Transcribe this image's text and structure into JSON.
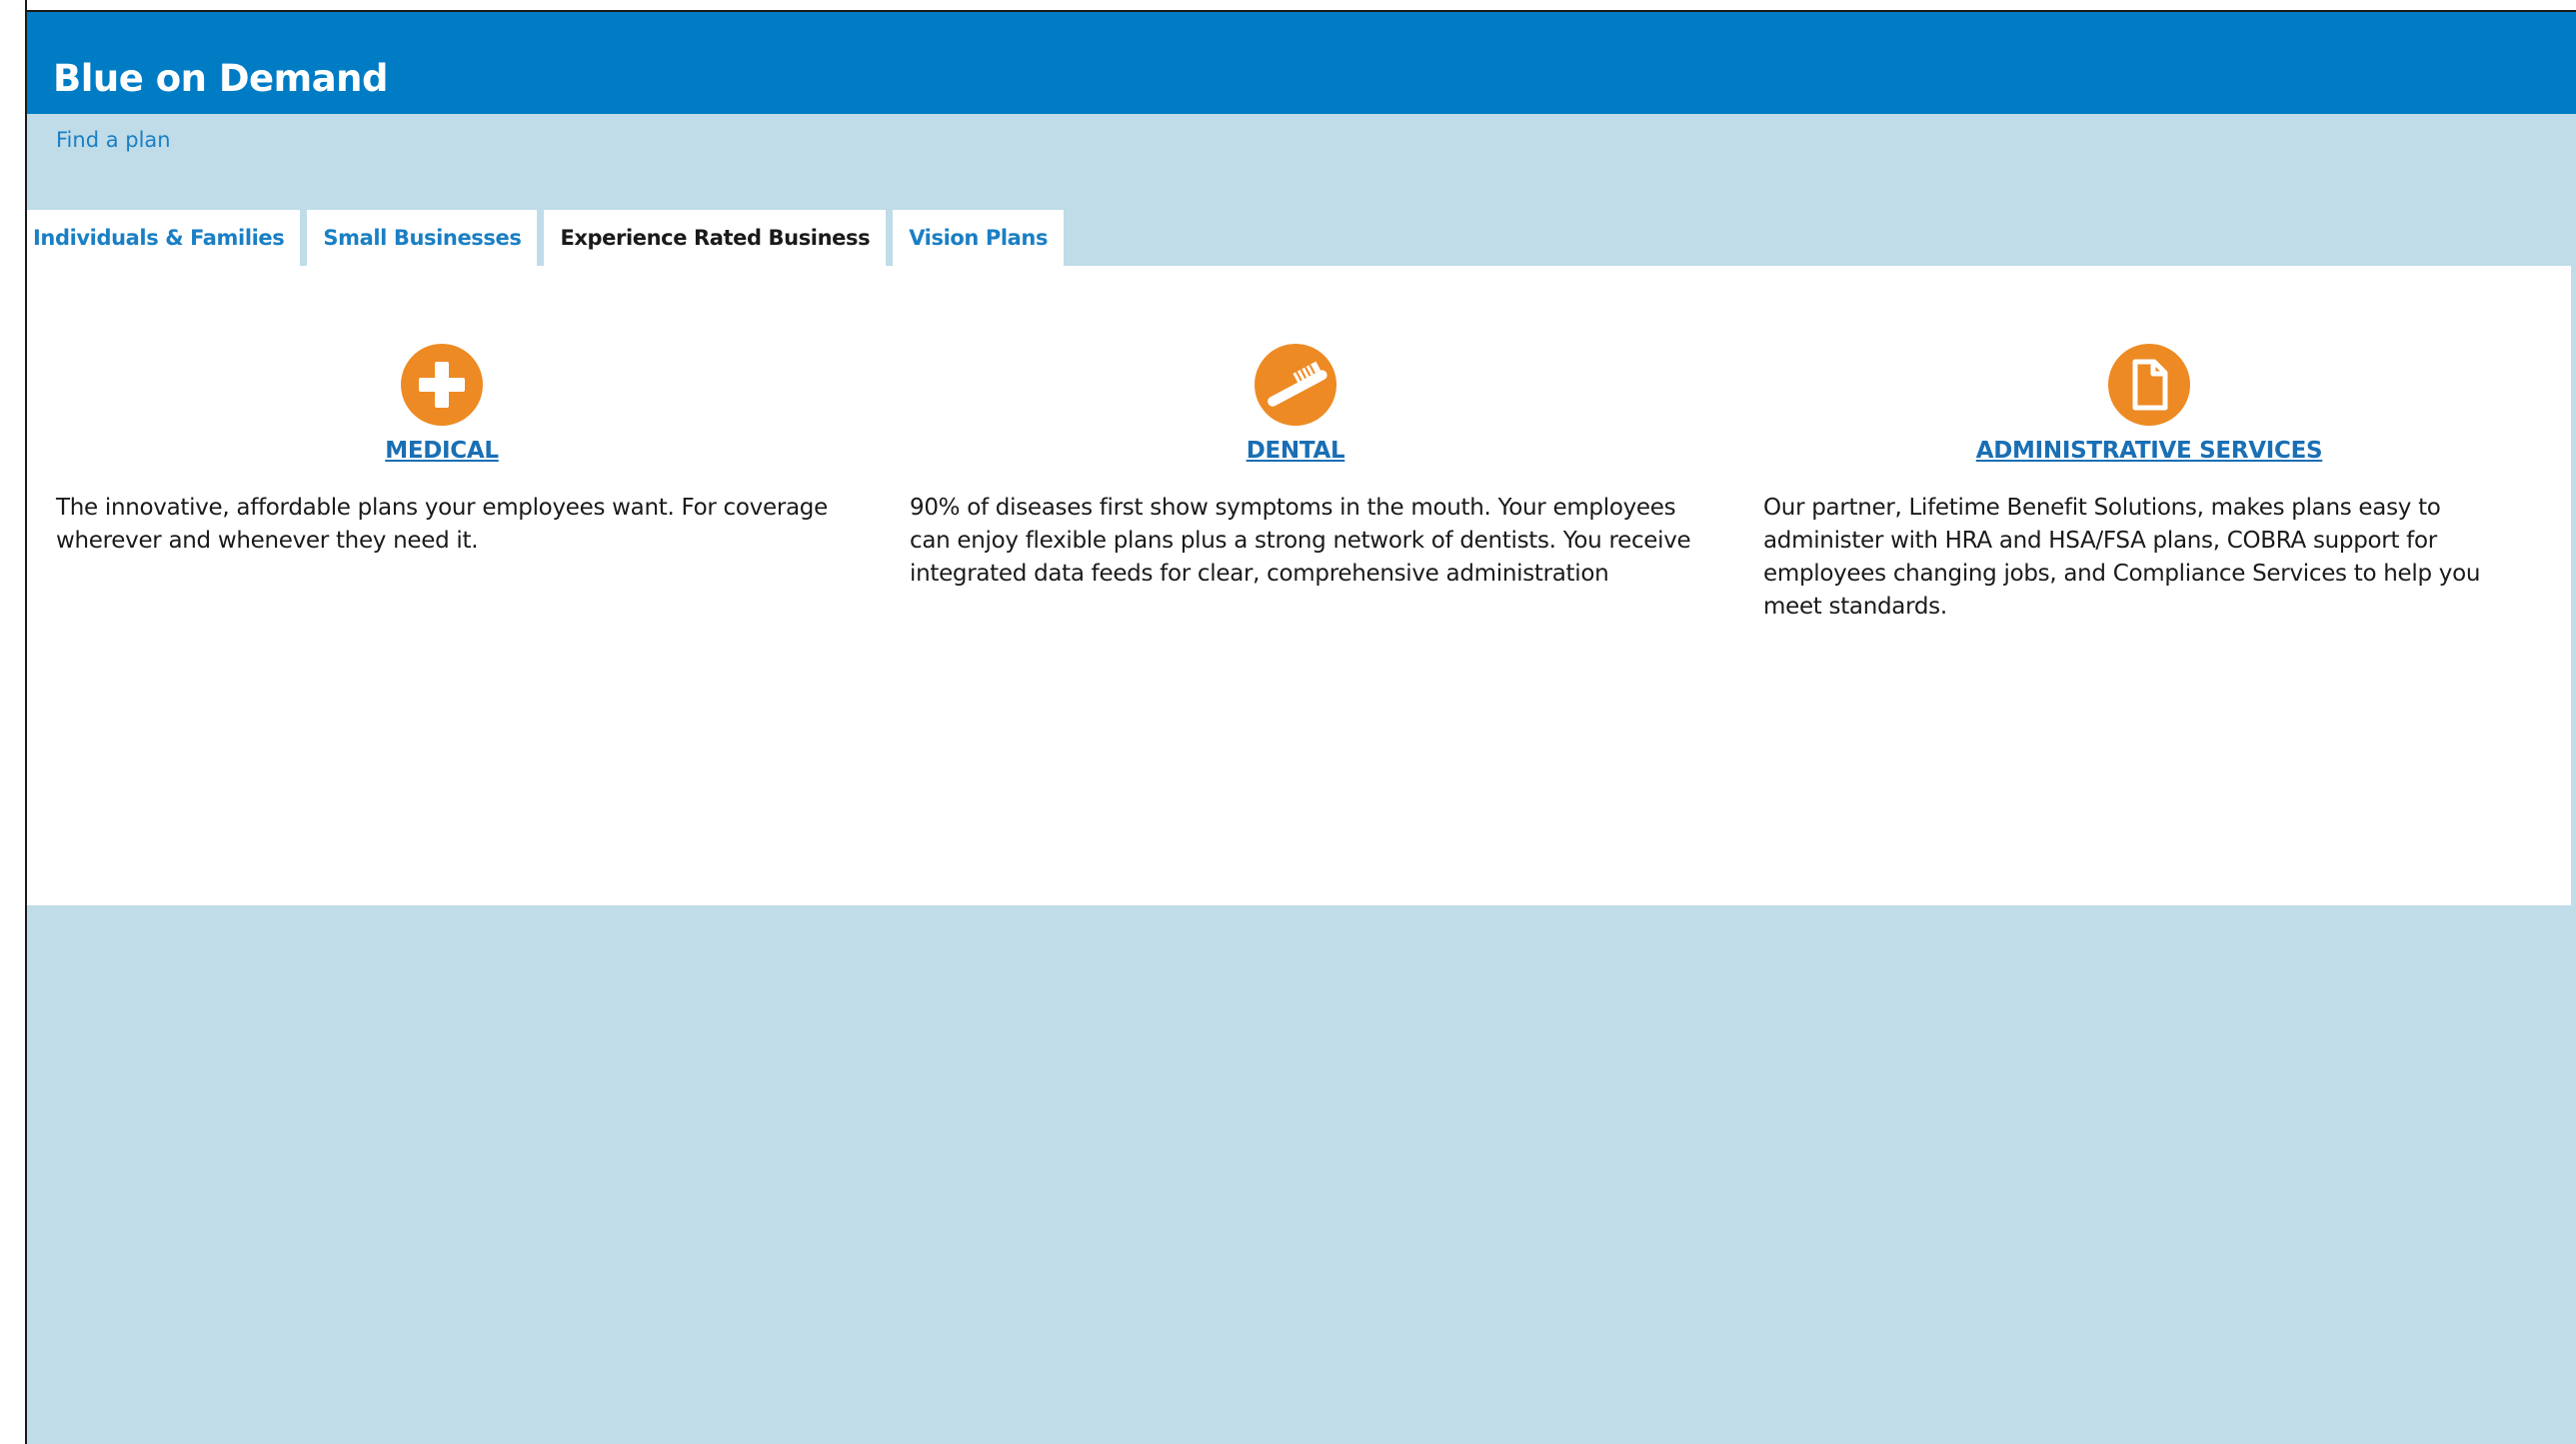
{
  "header": {
    "title": "Blue on Demand",
    "find_link": "Find a plan"
  },
  "tabs": [
    {
      "label": "Individuals & Families",
      "active": false
    },
    {
      "label": "Small Businesses",
      "active": false
    },
    {
      "label": "Experience Rated Business",
      "active": true
    },
    {
      "label": "Vision Plans",
      "active": false
    }
  ],
  "sections": [
    {
      "icon": "plus-icon",
      "title": "MEDICAL",
      "text": "The innovative, affordable plans your employees want. For coverage wherever and whenever they need it."
    },
    {
      "icon": "toothbrush-icon",
      "title": "DENTAL",
      "text": "90% of diseases first show symptoms in the mouth. Your employees can enjoy flexible plans plus a strong network of dentists. You receive integrated data feeds for clear, comprehensive administration"
    },
    {
      "icon": "document-icon",
      "title": "ADMINISTRATIVE SERVICES",
      "text": "Our partner, Lifetime Benefit Solutions, makes plans easy to administer with HRA and HSA/FSA plans, COBRA support for employees changing jobs, and Compliance Services to help you meet standards."
    }
  ],
  "colors": {
    "header_blue": "#007cc5",
    "page_background": "#bfdce8",
    "link_blue": "#1a7fc4",
    "icon_orange": "#ee8a23"
  }
}
